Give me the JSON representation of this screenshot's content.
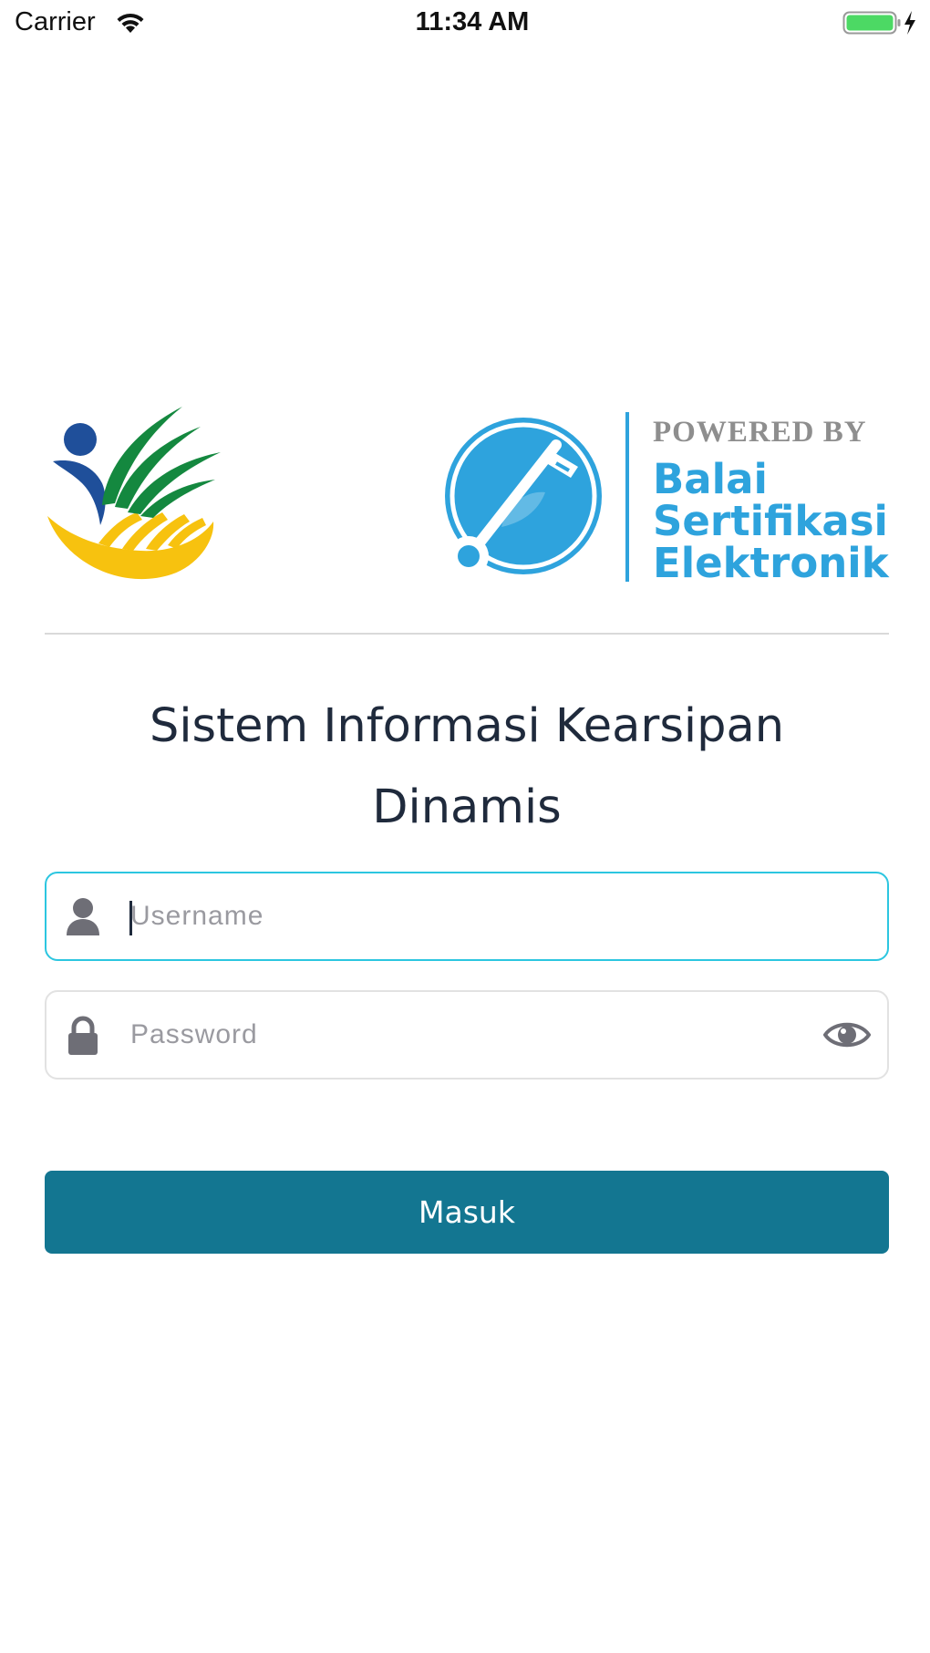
{
  "status_bar": {
    "carrier": "Carrier",
    "time": "11:34 AM",
    "icons": [
      "wifi-icon",
      "battery-icon",
      "charging-bolt-icon"
    ]
  },
  "logos": {
    "left": {
      "icon": "kemensos-logo"
    },
    "right": {
      "icon": "bse-key-logo",
      "powered_by": "POWERED BY",
      "name_line_1": "Balai",
      "name_line_2": "Sertifikasi",
      "name_line_3": "Elektronik"
    }
  },
  "title": {
    "line_1": "Sistem Informasi Kearsipan",
    "line_2": "Dinamis"
  },
  "form": {
    "username": {
      "placeholder": "Username",
      "value": "",
      "icon": "user-icon"
    },
    "password": {
      "placeholder": "Password",
      "value": "",
      "icon": "lock-icon",
      "toggle_icon": "eye-icon"
    },
    "submit_label": "Masuk"
  },
  "colors": {
    "accent": "#137691",
    "focus_border": "#2cc6e0",
    "title_text": "#1f2a3c",
    "icon_gray": "#6e6e76",
    "bse_blue": "#2ea3dd",
    "logo_green": "#14883f",
    "logo_yellow": "#f7c20f",
    "logo_navy": "#1f4f9a",
    "battery_green": "#4cd964"
  }
}
